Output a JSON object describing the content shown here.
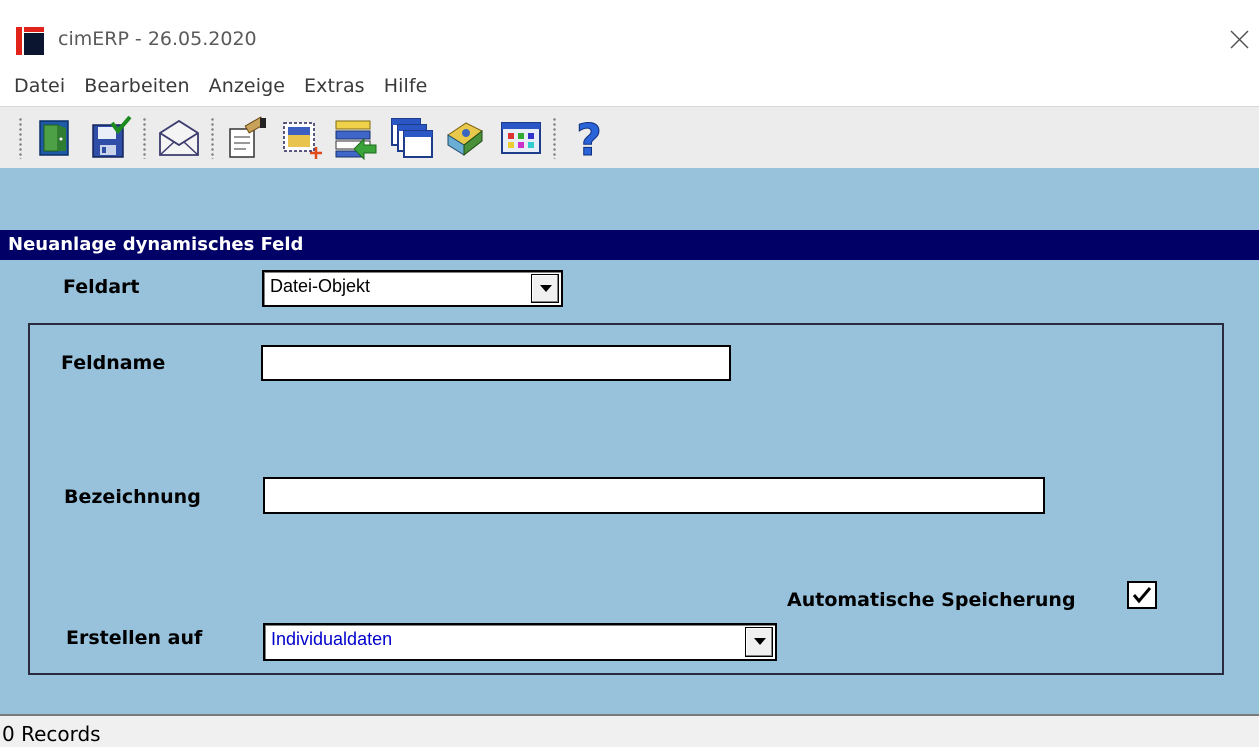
{
  "window": {
    "title": "cimERP - 26.05.2020"
  },
  "menu": {
    "items": [
      "Datei",
      "Bearbeiten",
      "Anzeige",
      "Extras",
      "Hilfe"
    ]
  },
  "toolbar": {
    "buttons": [
      {
        "name": "exit-door-icon"
      },
      {
        "name": "save-floppy-icon"
      },
      {
        "name": "mail-envelope-icon"
      },
      {
        "name": "edit-document-icon"
      },
      {
        "name": "new-selection-icon"
      },
      {
        "name": "list-import-icon"
      },
      {
        "name": "windows-cascade-icon"
      },
      {
        "name": "book-icon"
      },
      {
        "name": "grid-table-icon"
      },
      {
        "name": "help-question-icon"
      }
    ]
  },
  "form": {
    "header": "Neuanlage dynamisches Feld",
    "feldart_label": "Feldart",
    "feldart_value": "Datei-Objekt",
    "feldname_label": "Feldname",
    "feldname_value": "",
    "bezeichnung_label": "Bezeichnung",
    "bezeichnung_value": "",
    "auto_save_label": "Automatische Speicherung",
    "auto_save_checked": true,
    "erstellen_label": "Erstellen auf",
    "erstellen_value": "Individualdaten"
  },
  "status": {
    "records": "0 Records"
  },
  "colors": {
    "background": "#98c2dc",
    "header": "#000066",
    "dropdown_blue_text": "#0000cc"
  }
}
